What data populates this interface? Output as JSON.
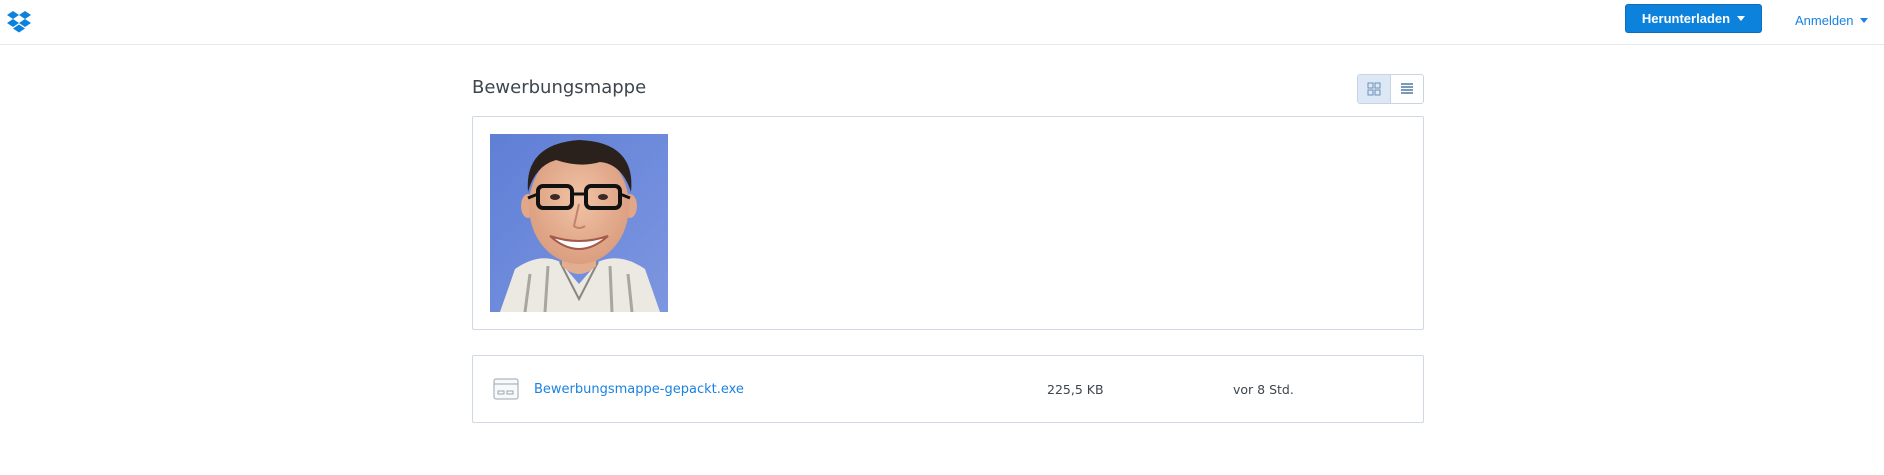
{
  "header": {
    "logo_icon": "dropbox-logo-icon",
    "download_label": "Herunterladen",
    "signin_label": "Anmelden",
    "accent_color": "#0d82dd"
  },
  "folder": {
    "title": "Bewerbungsmappe",
    "view_modes": [
      "grid-view-icon",
      "list-view-icon"
    ],
    "active_view": "grid"
  },
  "gallery": {
    "items": [
      {
        "type": "image",
        "description_icon": "portrait-photo"
      }
    ]
  },
  "files": [
    {
      "icon": "executable-file-icon",
      "name": "Bewerbungsmappe-gepackt.exe",
      "size": "225,5 KB",
      "modified": "vor 8 Std."
    }
  ]
}
